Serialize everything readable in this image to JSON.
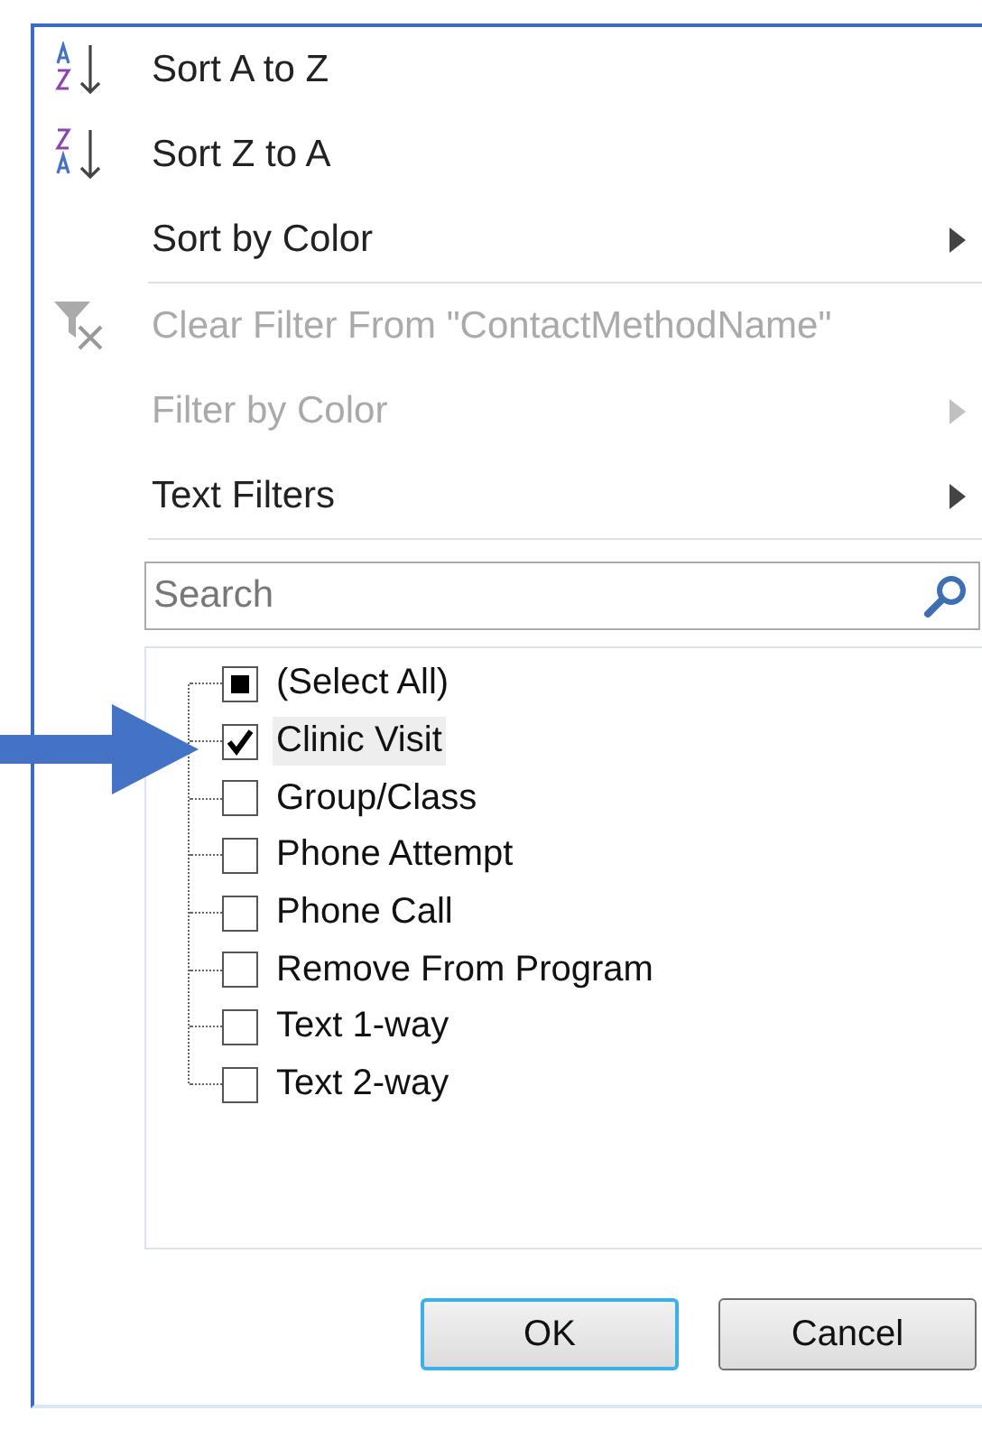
{
  "menu": [
    {
      "kind": "sort-az",
      "label": "Sort A to Z",
      "disabled": false,
      "submenu": false
    },
    {
      "kind": "sort-za",
      "label": "Sort Z to A",
      "disabled": false,
      "submenu": false
    },
    {
      "kind": "plain",
      "label": "Sort by Color",
      "disabled": false,
      "submenu": true
    },
    {
      "kind": "separator"
    },
    {
      "kind": "clear-filter",
      "label": "Clear Filter From \"ContactMethodName\"",
      "disabled": true,
      "submenu": false
    },
    {
      "kind": "plain",
      "label": "Filter by Color",
      "disabled": true,
      "submenu": true
    },
    {
      "kind": "plain",
      "label": "Text Filters",
      "disabled": false,
      "submenu": true
    },
    {
      "kind": "separator"
    }
  ],
  "search": {
    "placeholder": "Search"
  },
  "values": [
    {
      "label": "(Select All)",
      "checked": false,
      "partial": true,
      "selected": false
    },
    {
      "label": "Clinic Visit",
      "checked": true,
      "partial": false,
      "selected": true
    },
    {
      "label": "Group/Class",
      "checked": false,
      "partial": false,
      "selected": false
    },
    {
      "label": "Phone Attempt",
      "checked": false,
      "partial": false,
      "selected": false
    },
    {
      "label": "Phone Call",
      "checked": false,
      "partial": false,
      "selected": false
    },
    {
      "label": "Remove From Program",
      "checked": false,
      "partial": false,
      "selected": false
    },
    {
      "label": "Text 1-way",
      "checked": false,
      "partial": false,
      "selected": false
    },
    {
      "label": "Text 2-way",
      "checked": false,
      "partial": false,
      "selected": false
    }
  ],
  "buttons": [
    {
      "label": "OK",
      "default": true
    },
    {
      "label": "Cancel",
      "default": false
    }
  ]
}
